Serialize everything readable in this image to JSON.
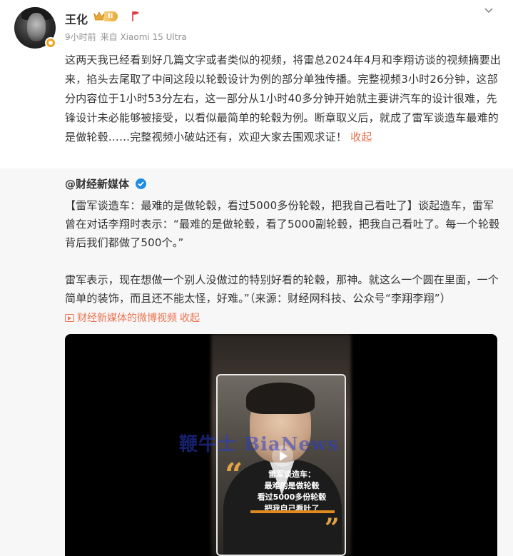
{
  "post": {
    "author": "王化",
    "vip_level": "II",
    "time": "9小时前",
    "source": "来自 Xiaomi 15 Ultra",
    "body_text": "这两天我已经看到好几篇文字或者类似的视频，将雷总2024年4月和李翔访谈的视频摘要出来，掐头去尾取了中间这段以轮毂设计为例的部分单独传播。完整视频3小时26分钟，这部分内容位于1小时53分左右，这一部分从1小时40多分钟开始就主要讲汽车的设计很难，先锋设计未必能够被接受，以看似最简单的轮毂为例。断章取义后，就成了雷军谈造车最难的是做轮毂……完整视频小破站还有，欢迎大家去围观求证！",
    "collapse_label": "收起"
  },
  "repost": {
    "author": "@财经新媒体",
    "paragraph1": "【雷军谈造车：最难的是做轮毂，看过5000多份轮毂，把我自己看吐了】谈起造车，雷军曾在对话李翔时表示：“最难的是做轮毂，看了5000副轮毂，把我自己看吐了。每一个轮毂背后我们都做了500个。”",
    "paragraph2": "雷军表示，现在想做一个别人没做过的特别好看的轮毂，那神。就这么一个圆在里面，一个简单的装饰，而且还不能太怪，好难。”（来源：财经网科技、公众号“李翔李翔”）",
    "video_link_label": "财经新媒体的微博视频",
    "collapse_label": "收起"
  },
  "video": {
    "caption": [
      "雷军谈造车：",
      "最难的是做轮毂",
      "看过5000多份轮毂",
      "把我自己看吐了"
    ],
    "watermark": "鞭牛士 BiaNews"
  },
  "colors": {
    "link": "#eb7350",
    "verified_blue": "#1e8ce5",
    "vip_gold": "#e9a535"
  }
}
